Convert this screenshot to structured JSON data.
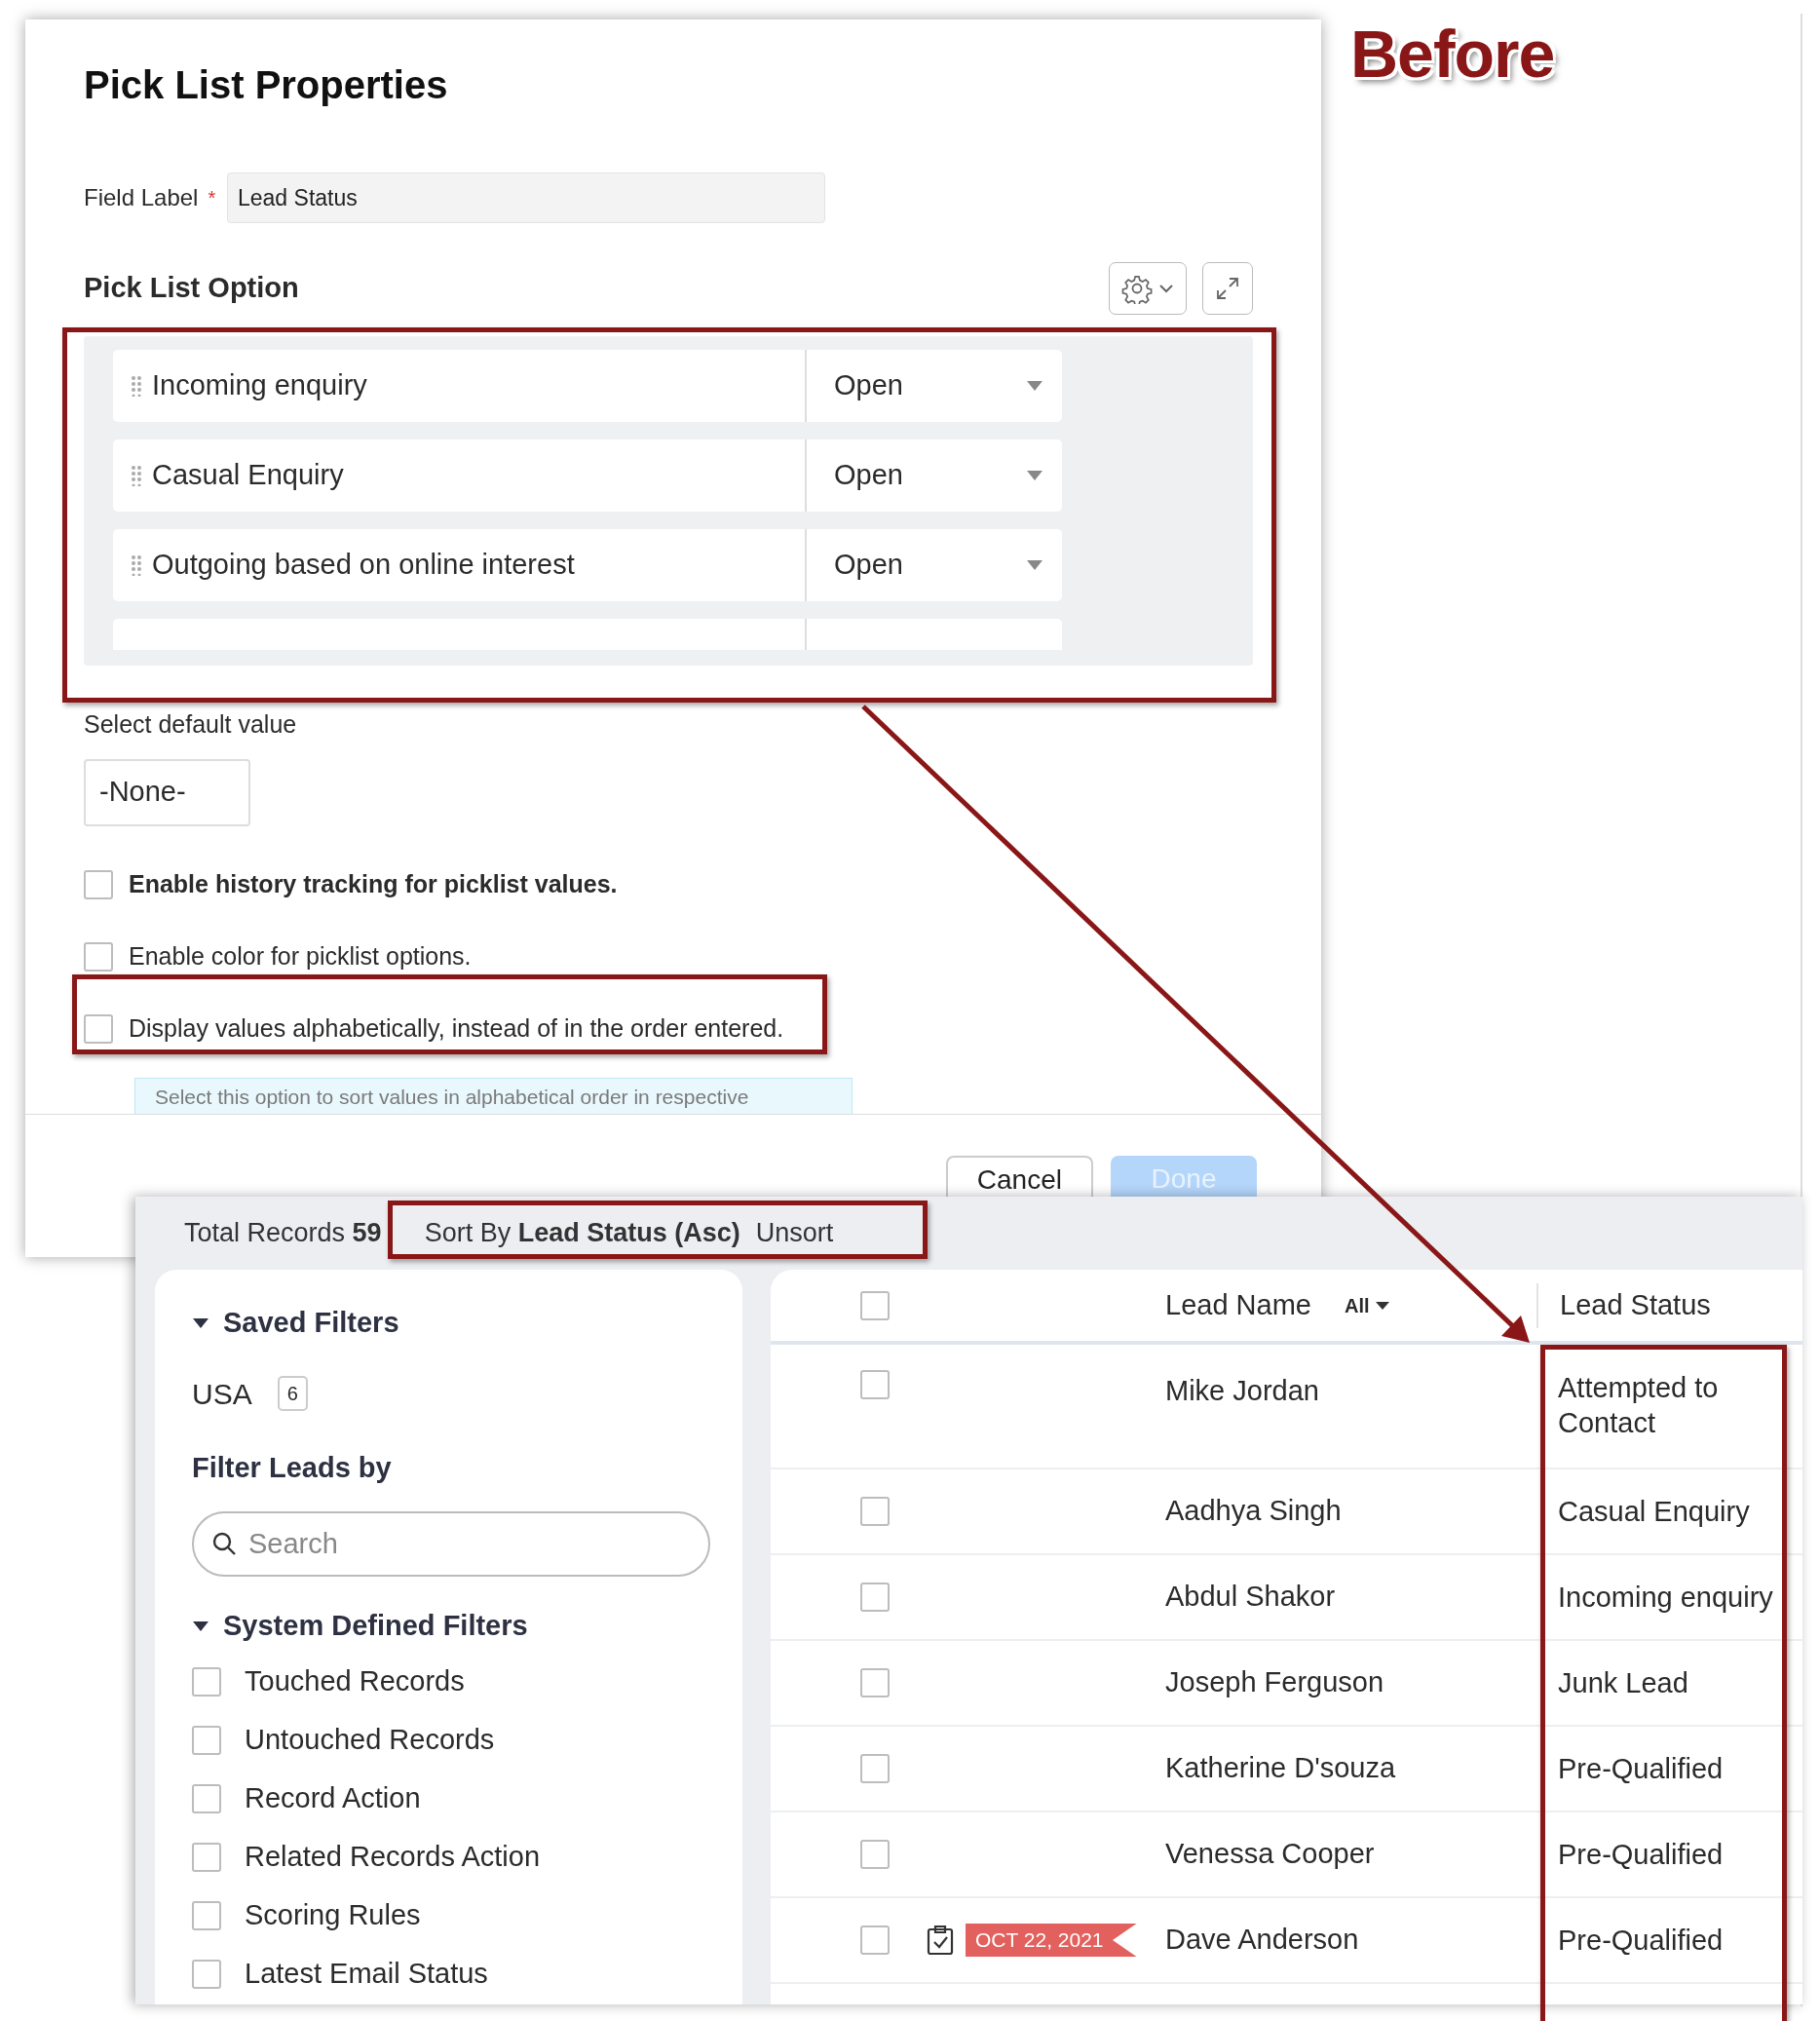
{
  "annotation": {
    "label": "Before"
  },
  "dialog": {
    "title": "Pick List Properties",
    "field_label": {
      "label": "Field Label",
      "required_mark": "*",
      "value": "Lead Status"
    },
    "section_title": "Pick List Option",
    "options": [
      {
        "name": "Incoming enquiry",
        "status": "Open"
      },
      {
        "name": "Casual Enquiry",
        "status": "Open"
      },
      {
        "name": "Outgoing based on online interest",
        "status": "Open"
      }
    ],
    "more_rows_below": true,
    "default_value": {
      "label": "Select default value",
      "value": "-None-"
    },
    "checkboxes": [
      {
        "label": "Enable history tracking for picklist values.",
        "checked": false,
        "bold": true
      },
      {
        "label": "Enable color for picklist options.",
        "checked": false,
        "bold": false
      },
      {
        "label": "Display values alphabetically, instead of in the order entered.",
        "checked": false,
        "bold": false
      }
    ],
    "info_text": "Select this option to sort values in alphabetical order in respective",
    "buttons": [
      {
        "label": "Cancel",
        "kind": "secondary",
        "disabled": false
      },
      {
        "label": "Done",
        "kind": "primary",
        "disabled": true
      }
    ]
  },
  "list_view": {
    "total": "Total Records **59**",
    "sort": "Sort By **Lead Status (Asc)**",
    "unsort": "Unsort",
    "sidebar": {
      "saved_title": "Saved Filters",
      "saved_expanded": true,
      "saved": [
        {
          "name": "USA",
          "count": "6"
        }
      ],
      "filter_title": "Filter Leads by",
      "search": {
        "placeholder": "Search"
      },
      "system_title": "System Defined Filters",
      "system_expanded": true,
      "system": [
        {
          "label": "Touched Records",
          "checked": false
        },
        {
          "label": "Untouched Records",
          "checked": false
        },
        {
          "label": "Record Action",
          "checked": false
        },
        {
          "label": "Related Records Action",
          "checked": false
        },
        {
          "label": "Scoring Rules",
          "checked": false
        },
        {
          "label": "Latest Email Status",
          "checked": false
        }
      ]
    },
    "table": {
      "columns": [
        "Lead Name",
        "Lead Status"
      ],
      "name_filter": "All",
      "all_checked": false,
      "rows": [
        {
          "checked": false,
          "name": "Mike Jordan",
          "status": "Attempted to Contact"
        },
        {
          "checked": false,
          "name": "Aadhya Singh",
          "status": "Casual Enquiry"
        },
        {
          "checked": false,
          "name": "Abdul Shakor",
          "status": "Incoming enquiry"
        },
        {
          "checked": false,
          "name": "Joseph Ferguson",
          "status": "Junk Lead"
        },
        {
          "checked": false,
          "name": "Katherine D'souza",
          "status": "Pre-Qualified"
        },
        {
          "checked": false,
          "name": "Venessa Cooper",
          "status": "Pre-Qualified"
        },
        {
          "checked": false,
          "name": "Dave Anderson",
          "status": "Pre-Qualified",
          "task_due": "OCT 22, 2021"
        }
      ]
    }
  }
}
